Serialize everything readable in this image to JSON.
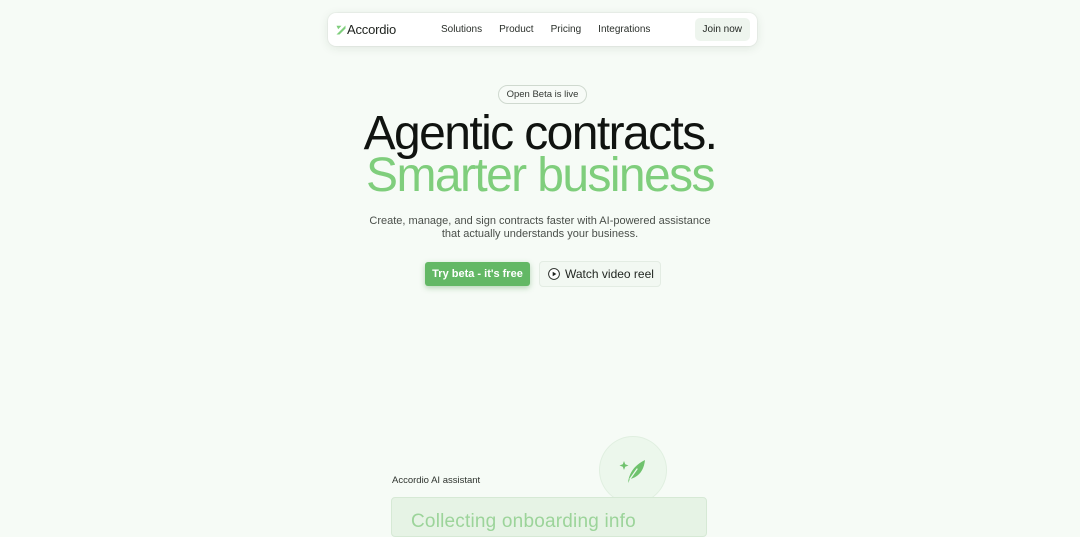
{
  "nav": {
    "brand": "Accordio",
    "links": [
      "Solutions",
      "Product",
      "Pricing",
      "Integrations"
    ],
    "join_label": "Join now"
  },
  "hero": {
    "badge": "Open Beta is live",
    "headline_line1": "Agentic contracts.",
    "headline_line2": "Smarter business",
    "subtitle_line1": "Create, manage, and sign contracts faster with AI-powered assistance",
    "subtitle_line2": "that actually understands your business.",
    "cta_primary": "Try beta - it's free",
    "cta_secondary": "Watch video reel"
  },
  "assistant": {
    "label": "Accordio AI assistant",
    "card_text": "Collecting onboarding info"
  },
  "icons": {
    "logo": "accordio-leaf-logo",
    "play": "play-icon",
    "feather": "feather-sparkle-icon"
  },
  "colors": {
    "accent_green": "#7fce7c",
    "button_green": "#63b865",
    "background": "#f6fbf6"
  }
}
